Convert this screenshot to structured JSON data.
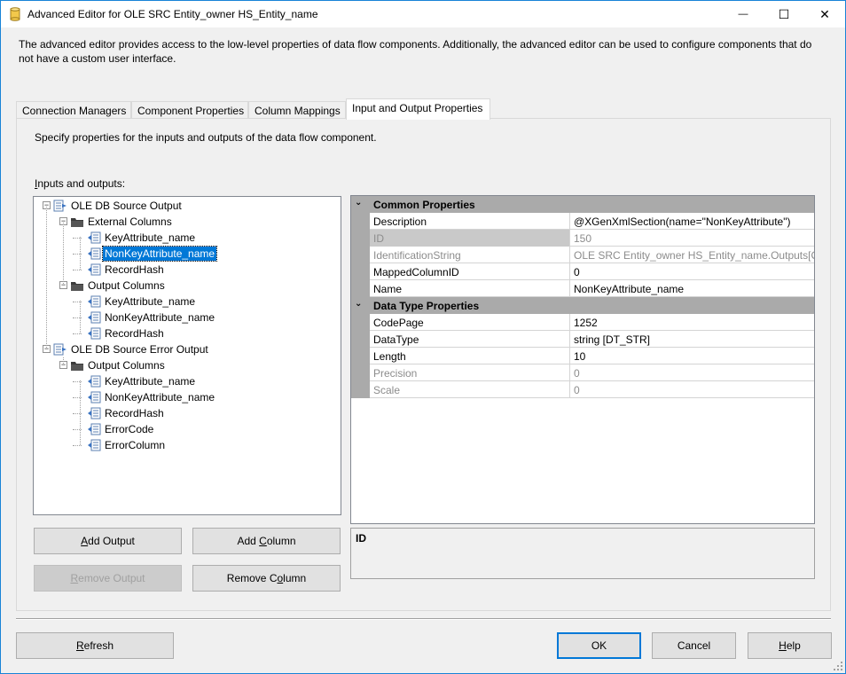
{
  "window": {
    "title": "Advanced Editor for OLE SRC Entity_owner HS_Entity_name",
    "minimize_glyph": "—",
    "maximize_glyph": "☐",
    "close_glyph": "✕"
  },
  "description": "The advanced editor provides access to the low-level properties of data flow components. Additionally, the advanced editor can be used to configure components that do not have a custom user interface.",
  "tabs": [
    {
      "label": "Connection Managers",
      "active": false
    },
    {
      "label": "Component Properties",
      "active": false
    },
    {
      "label": "Column Mappings",
      "active": false
    },
    {
      "label": "Input and Output Properties",
      "active": true
    }
  ],
  "panel": {
    "description": "Specify properties for the inputs and outputs of the data flow component.",
    "io_label": "Inputs and outputs:"
  },
  "tree": {
    "nodes": [
      {
        "label": "OLE DB Source Output",
        "level": 0,
        "type": "output",
        "expanded": true
      },
      {
        "label": "External Columns",
        "level": 1,
        "type": "folder",
        "expanded": true
      },
      {
        "label": "KeyAttribute_name",
        "level": 2,
        "type": "column"
      },
      {
        "label": "NonKeyAttribute_name",
        "level": 2,
        "type": "column",
        "selected": true
      },
      {
        "label": "RecordHash",
        "level": 2,
        "type": "column"
      },
      {
        "label": "Output Columns",
        "level": 1,
        "type": "folder",
        "expanded": true
      },
      {
        "label": "KeyAttribute_name",
        "level": 2,
        "type": "column"
      },
      {
        "label": "NonKeyAttribute_name",
        "level": 2,
        "type": "column"
      },
      {
        "label": "RecordHash",
        "level": 2,
        "type": "column"
      },
      {
        "label": "OLE DB Source Error Output",
        "level": 0,
        "type": "output",
        "expanded": true
      },
      {
        "label": "Output Columns",
        "level": 1,
        "type": "folder",
        "expanded": true
      },
      {
        "label": "KeyAttribute_name",
        "level": 2,
        "type": "column"
      },
      {
        "label": "NonKeyAttribute_name",
        "level": 2,
        "type": "column"
      },
      {
        "label": "RecordHash",
        "level": 2,
        "type": "column"
      },
      {
        "label": "ErrorCode",
        "level": 2,
        "type": "column"
      },
      {
        "label": "ErrorColumn",
        "level": 2,
        "type": "column"
      }
    ]
  },
  "buttons": {
    "add_output": {
      "pre": "",
      "key": "A",
      "post": "dd Output",
      "enabled": true
    },
    "add_column": {
      "pre": "Add ",
      "key": "C",
      "post": "olumn",
      "enabled": true
    },
    "remove_output": {
      "pre": "",
      "key": "R",
      "post": "emove Output",
      "enabled": false
    },
    "remove_column": {
      "pre": "Remove C",
      "key": "o",
      "post": "lumn",
      "enabled": true
    },
    "refresh": {
      "pre": "",
      "key": "R",
      "post": "efresh"
    },
    "ok": {
      "label": "OK"
    },
    "cancel": {
      "label": "Cancel"
    },
    "help": {
      "pre": "",
      "key": "H",
      "post": "elp"
    }
  },
  "properties": {
    "categories": [
      {
        "name": "Common Properties",
        "toggle": "⌄",
        "rows": [
          {
            "name": "Description",
            "value": "@XGenXmlSection(name=\"NonKeyAttribute\")",
            "readonly": false
          },
          {
            "name": "ID",
            "value": "150",
            "readonly": true,
            "highlight": true
          },
          {
            "name": "IdentificationString",
            "value": "OLE SRC Entity_owner HS_Entity_name.Outputs[OLE",
            "readonly": true
          },
          {
            "name": "MappedColumnID",
            "value": "0",
            "readonly": false
          },
          {
            "name": "Name",
            "value": "NonKeyAttribute_name",
            "readonly": false
          }
        ]
      },
      {
        "name": "Data Type Properties",
        "toggle": "⌄",
        "rows": [
          {
            "name": "CodePage",
            "value": "1252",
            "readonly": false
          },
          {
            "name": "DataType",
            "value": "string [DT_STR]",
            "readonly": false
          },
          {
            "name": "Length",
            "value": "10",
            "readonly": false
          },
          {
            "name": "Precision",
            "value": "0",
            "readonly": true
          },
          {
            "name": "Scale",
            "value": "0",
            "readonly": true
          }
        ]
      }
    ]
  },
  "property_description": {
    "title": "ID"
  }
}
